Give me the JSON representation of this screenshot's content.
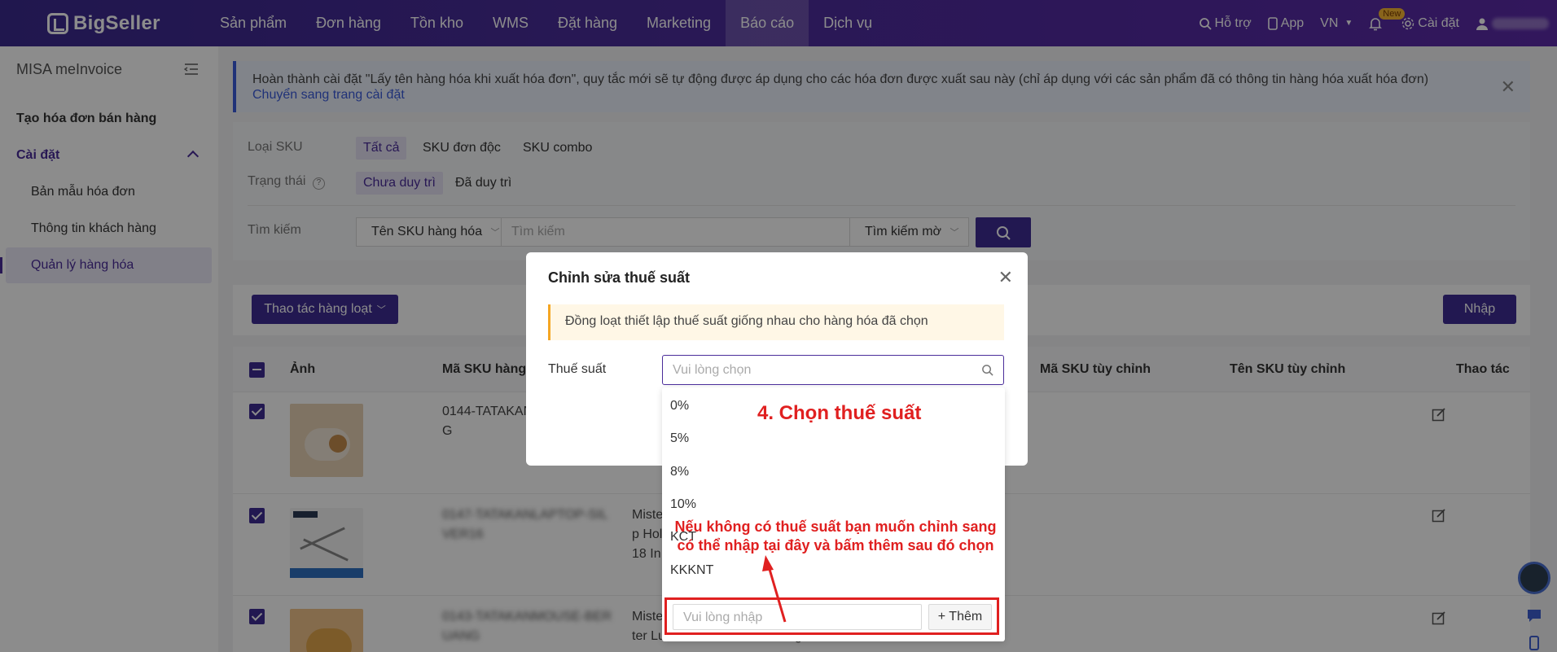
{
  "topnav": {
    "logo": "BigSeller",
    "items": [
      "Sản phẩm",
      "Đơn hàng",
      "Tồn kho",
      "WMS",
      "Đặt hàng",
      "Marketing",
      "Báo cáo",
      "Dịch vụ"
    ],
    "support": "Hỗ trợ",
    "app": "App",
    "lang": "VN",
    "new_badge": "New",
    "settings": "Cài đặt"
  },
  "sidebar": {
    "title": "MISA meInvoice",
    "items": [
      {
        "label": "Tạo hóa đơn bán hàng"
      },
      {
        "label": "Cài đặt"
      },
      {
        "label": "Bản mẫu hóa đơn"
      },
      {
        "label": "Thông tin khách hàng"
      },
      {
        "label": "Quản lý hàng hóa"
      }
    ]
  },
  "notice": {
    "text": "Hoàn thành cài đặt \"Lấy tên hàng hóa khi xuất hóa đơn\", quy tắc mới sẽ tự động được áp dụng cho các hóa đơn được xuất sau này (chỉ áp dụng với các sản phẩm đã có thông tin hàng hóa xuất hóa đơn)",
    "link": "Chuyển sang trang cài đặt"
  },
  "filter": {
    "sku_type_label": "Loại SKU",
    "sku_type_options": [
      "Tất cả",
      "SKU đơn độc",
      "SKU combo"
    ],
    "status_label": "Trạng thái",
    "status_options": [
      "Chưa duy trì",
      "Đã duy trì"
    ],
    "search_label": "Tìm kiếm",
    "search_field": "Tên SKU hàng hóa",
    "search_placeholder": "Tìm kiếm",
    "search_mode": "Tìm kiếm mờ"
  },
  "toolbar": {
    "bulk_label": "Thao tác hàng loạt",
    "import_label": "Nhập"
  },
  "table": {
    "headers": [
      "Ảnh",
      "Mã SKU hàng h",
      "Mã SKU tùy chỉnh",
      "Tên SKU tùy chỉnh",
      "Thao tác"
    ],
    "rows": [
      {
        "sku": "0144-TATAKAN",
        "sku2": "G",
        "name": ""
      },
      {
        "sku": "0147-TATAKANLAPTOP-SIL",
        "sku2": "VER16",
        "name": "Miste",
        "name2": "p Hol",
        "name3": "18 In"
      },
      {
        "sku": "0143-TATAKANMOUSE-BER",
        "sku2": "UANG",
        "name": "Miste",
        "name2": "ter Lucu Tatakan Mouse Pergelan",
        "name3": ""
      }
    ]
  },
  "modal": {
    "title": "Chỉnh sửa thuế suất",
    "warning": "Đồng loạt thiết lập thuế suất giống nhau cho hàng hóa đã chọn",
    "field_label": "Thuế suất",
    "field_placeholder": "Vui lòng chọn"
  },
  "dropdown": {
    "options": [
      "0%",
      "5%",
      "8%",
      "10%",
      "KCT",
      "KKKNT"
    ],
    "add_placeholder": "Vui lòng nhập",
    "add_button": "+ Thêm"
  },
  "annotations": {
    "step": "4. Chọn thuế suất",
    "hint_line1": "Nếu không có thuế suất bạn muốn chỉnh sang",
    "hint_line2": "có thể nhập tại đây và bấm thêm sau đó chọn"
  },
  "colors": {
    "brand": "#3f2d94",
    "annotation": "#e02020"
  }
}
